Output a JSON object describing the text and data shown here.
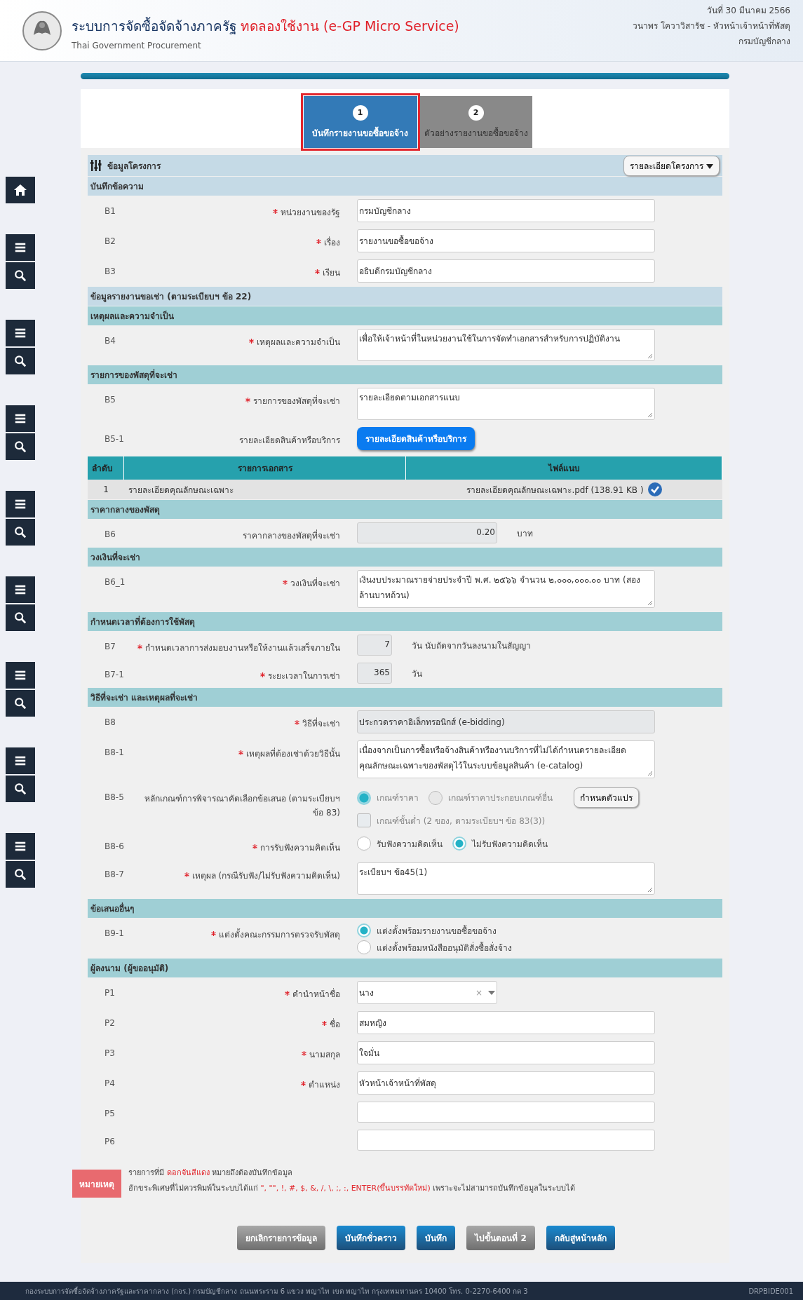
{
  "header": {
    "title": "ระบบการจัดซื้อจัดจ้างภาครัฐ",
    "title_highlight": "ทดลองใช้งาน (e-GP Micro Service)",
    "subtitle": "Thai Government Procurement",
    "date": "วันที่ 30 มีนาคม 2566",
    "user": "วนาพร โควาวิสารัช - หัวหน้าเจ้าหน้าที่พัสดุ",
    "department": "กรมบัญชีกลาง"
  },
  "steps": [
    {
      "number": "1",
      "label": "บันทึกรายงานขอซื้อขอจ้าง",
      "selected": true
    },
    {
      "number": "2",
      "label": "ตัวอย่างรายงานขอซื้อขอจ้าง",
      "selected": false
    }
  ],
  "project_bar": {
    "title": "ข้อมูลโครงการ",
    "dropdown": "รายละเอียดโครงการ"
  },
  "sections": [
    {
      "title": "บันทึกข้อความ",
      "kind": "group",
      "items": [
        {
          "kind": "input",
          "code": "B1",
          "label": "หน่วยงานของรัฐ",
          "required": true,
          "value": "กรมบัญชีกลาง",
          "readonly": false
        },
        {
          "kind": "input",
          "code": "B2",
          "label": "เรื่อง",
          "required": true,
          "value": "รายงานขอซื้อขอจ้าง",
          "readonly": false
        },
        {
          "kind": "input",
          "code": "B3",
          "label": "เรียน",
          "required": true,
          "value": "อธิบดีกรมบัญชีกลาง",
          "readonly": false
        }
      ]
    },
    {
      "title": "ข้อมูลรายงานขอเช่า (ตามระเบียบฯ ข้อ 22)",
      "kind": "group"
    },
    {
      "title": "เหตุผลและความจำเป็น",
      "kind": "sub",
      "items": [
        {
          "kind": "textarea",
          "code": "B4",
          "label": "เหตุผลและความจำเป็น",
          "required": true,
          "value": "เพื่อให้เจ้าหน้าที่ในหน่วยงานใช้ในการจัดทำเอกสารสำหรับการปฏิบัติงาน"
        }
      ]
    },
    {
      "title": "รายการของพัสดุที่จะเช่า",
      "kind": "sub",
      "items": [
        {
          "kind": "textarea",
          "code": "B5",
          "label": "รายการของพัสดุที่จะเช่า",
          "required": true,
          "value": "รายละเอียดตามเอกสารแนบ"
        },
        {
          "kind": "button",
          "code": "B5-1",
          "label": "รายละเอียดสินค้าหรือบริการ",
          "required": false,
          "button": "รายละเอียดสินค้าหรือบริการ"
        },
        {
          "kind": "table",
          "columns": [
            "ลำดับ",
            "รายการเอกสาร",
            "ไฟล์แนบ"
          ],
          "rows": [
            {
              "cells": [
                "1",
                "รายละเอียดคุณลักษณะเฉพาะ",
                "รายละเอียดคุณลักษณะเฉพาะ.pdf (138.91 KB )"
              ],
              "verified": true
            }
          ]
        }
      ]
    },
    {
      "title": "ราคากลางของพัสดุ",
      "kind": "sub",
      "items": [
        {
          "kind": "amount",
          "code": "B6",
          "label": "ราคากลางของพัสดุที่จะเช่า",
          "required": false,
          "value": "0.20",
          "unit": "บาท",
          "readonly": true
        }
      ]
    },
    {
      "title": "วงเงินที่จะเช่า",
      "kind": "sub",
      "items": [
        {
          "kind": "textarea",
          "code": "B6_1",
          "label": "วงเงินที่จะเช่า",
          "required": true,
          "value": "เงินงบประมาณรายจ่ายประจำปี พ.ศ. ๒๕๖๖ จำนวน ๒,๐๐๐,๐๐๐.๐๐ บาท  (สองล้านบาทถ้วน)"
        }
      ]
    },
    {
      "title": "กำหนดเวลาที่ต้องการใช้พัสดุ",
      "kind": "sub",
      "items": [
        {
          "kind": "number",
          "code": "B7",
          "label": "กำหนดเวลาการส่งมอบงานหรือให้งานแล้วเสร็จภายใน",
          "required": true,
          "value": "7",
          "unit": "วัน นับถัดจากวันลงนามในสัญญา",
          "readonly": true
        },
        {
          "kind": "number",
          "code": "B7-1",
          "label": "ระยะเวลาในการเช่า",
          "required": true,
          "value": "365",
          "unit": "วัน",
          "readonly": true
        }
      ]
    },
    {
      "title": "วิธีที่จะเช่า และเหตุผลที่จะเช่า",
      "kind": "sub",
      "items": [
        {
          "kind": "input",
          "code": "B8",
          "label": "วิธีที่จะเช่า",
          "required": true,
          "value": "ประกวดราคาอิเล็กทรอนิกส์ (e-bidding)",
          "readonly": true
        },
        {
          "kind": "textarea",
          "code": "B8-1",
          "label": "เหตุผลที่ต้องเช่าด้วยวิธีนั้น",
          "required": true,
          "value": "เนื่องจากเป็นการซื้อหรือจ้างสินค้าหรืองานบริการที่ไม่ได้กำหนดรายละเอียดคุณลักษณะเฉพาะของพัสดุไว้ในระบบข้อมูลสินค้า (e-catalog)"
        },
        {
          "kind": "criteria",
          "code": "B8-5",
          "label": "หลักเกณฑ์การพิจารณาคัดเลือกข้อเสนอ (ตามระเบียบฯ ข้อ 83)",
          "required": false,
          "options": [
            {
              "label": "เกณฑ์ราคา",
              "selected": true,
              "disabled": true
            },
            {
              "label": "เกณฑ์ราคาประกอบเกณฑ์อื่น",
              "selected": false,
              "disabled": true
            }
          ],
          "button": "กำหนดตัวแปร",
          "checkbox": {
            "label": "เกณฑ์ขั้นต่ำ (2 ของ, ตามระเบียบฯ ข้อ 83(3))",
            "checked": false,
            "disabled": true
          }
        },
        {
          "kind": "radio",
          "code": "B8-6",
          "label": "การรับฟังความคิดเห็น",
          "required": true,
          "options": [
            {
              "label": "รับฟังความคิดเห็น",
              "selected": false,
              "disabled": false
            },
            {
              "label": "ไม่รับฟังความคิดเห็น",
              "selected": true,
              "disabled": false
            }
          ]
        },
        {
          "kind": "textarea",
          "code": "B8-7",
          "label": "เหตุผล (กรณีรับฟัง/ไม่รับฟังความคิดเห็น)",
          "required": true,
          "value": "ระเบียบฯ ข้อ45(1)"
        }
      ]
    },
    {
      "title": "ข้อเสนออื่นๆ",
      "kind": "sub",
      "items": [
        {
          "kind": "radio-stack",
          "code": "B9-1",
          "label": "แต่งตั้งคณะกรรมการตรวจรับพัสดุ",
          "required": true,
          "options": [
            {
              "label": "แต่งตั้งพร้อมรายงานขอซื้อขอจ้าง",
              "selected": true,
              "disabled": false
            },
            {
              "label": "แต่งตั้งพร้อมหนังสืออนุมัติสั่งซื้อสั่งจ้าง",
              "selected": false,
              "disabled": false
            }
          ]
        }
      ]
    },
    {
      "title": "ผู้ลงนาม (ผู้ขออนุมัติ)",
      "kind": "sub",
      "items": [
        {
          "kind": "select",
          "code": "P1",
          "label": "คำนำหน้าชื่อ",
          "required": true,
          "value": "นาง",
          "clear": "×"
        },
        {
          "kind": "input",
          "code": "P2",
          "label": "ชื่อ",
          "required": true,
          "value": "สมหญิง",
          "readonly": false
        },
        {
          "kind": "input",
          "code": "P3",
          "label": "นามสกุล",
          "required": true,
          "value": "ใจมั่น",
          "readonly": false
        },
        {
          "kind": "input",
          "code": "P4",
          "label": "ตำแหน่ง",
          "required": true,
          "value": "หัวหน้าเจ้าหน้าที่พัสดุ",
          "readonly": false
        },
        {
          "kind": "input",
          "code": "P5",
          "required": false,
          "readonly": false
        },
        {
          "kind": "input",
          "code": "P6",
          "required": false,
          "readonly": false
        }
      ]
    }
  ],
  "note": {
    "badge": "หมายเหตุ",
    "lines": [
      [
        {
          "text": "รายการที่มี ",
          "red": false
        },
        {
          "text": "ดอกจันสีแดง",
          "red": true
        },
        {
          "text": " หมายถึงต้องบันทึกข้อมูล",
          "red": false
        }
      ],
      [
        {
          "text": "อักขระพิเศษที่ไม่ควรพิมพ์ในระบบได้แก่ ",
          "red": false
        },
        {
          "text": "\", \"\", !, #, $, &, /, \\, ;, :, ENTER(ขึ้นบรรทัดใหม่)",
          "red": true
        },
        {
          "text": " เพราะจะไม่สามารถบันทึกข้อมูลในระบบได้",
          "red": false
        }
      ]
    ]
  },
  "buttons": [
    {
      "label": "ยกเลิกรายการข้อมูล",
      "disabled": true
    },
    {
      "label": "บันทึกชั่วคราว",
      "disabled": false
    },
    {
      "label": "บันทึก",
      "disabled": false
    },
    {
      "label": "ไปขั้นตอนที่ 2",
      "disabled": true
    },
    {
      "label": "กลับสู่หน้าหลัก",
      "disabled": false
    }
  ],
  "footer": {
    "address": "กองระบบการจัดซื้อจัดจ้างภาครัฐและราคากลาง (กจร.) กรมบัญชีกลาง ถนนพระราม 6 แขวง พญาไท เขต พญาไท กรุงเทพมหานคร 10400 โทร. 0-2270-6400 กด 3",
    "code": "DRPBIDE001"
  }
}
